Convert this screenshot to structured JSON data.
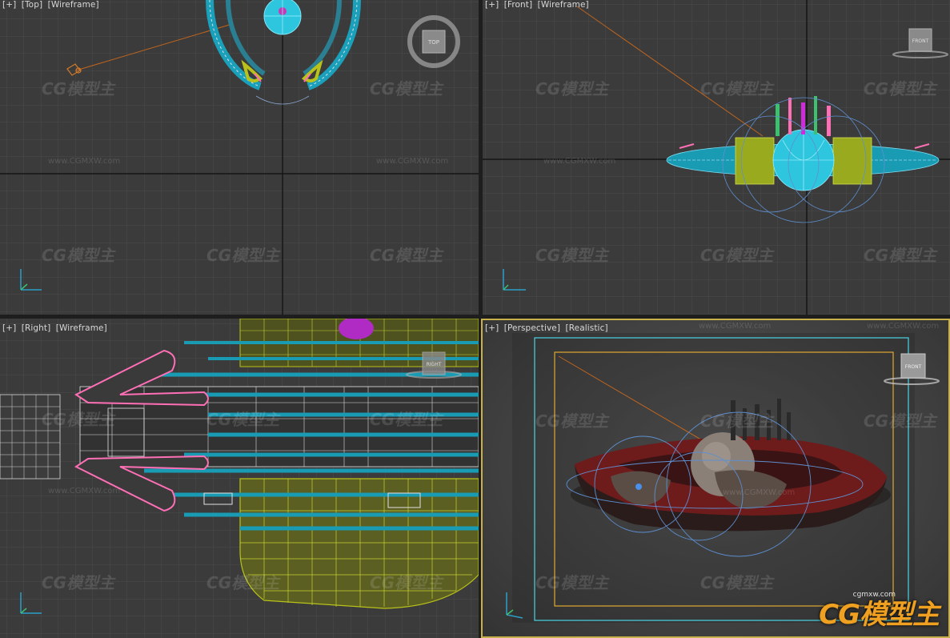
{
  "viewports": {
    "top": {
      "plus": "[+]",
      "view": "[Top]",
      "shading": "[Wireframe]",
      "cube": "TOP"
    },
    "front": {
      "plus": "[+]",
      "view": "[Front]",
      "shading": "[Wireframe]",
      "cube": "FRONT"
    },
    "right": {
      "plus": "[+]",
      "view": "[Right]",
      "shading": "[Wireframe]",
      "cube": "RIGHT"
    },
    "persp": {
      "plus": "[+]",
      "view": "[Perspective]",
      "shading": "[Realistic]",
      "cube": "FRONT"
    }
  },
  "watermark": {
    "brand": "CG模型主",
    "url": "www.CGMXW.com"
  },
  "logo": {
    "text": "CG模型主",
    "url": "cgmxw.com"
  },
  "axis": {
    "x": "x",
    "y": "y",
    "z": "z"
  },
  "colors": {
    "viewport_bg": "#3b3b3b",
    "grid_minor": "#4a4a4a",
    "grid_major": "#262626",
    "active_border": "#c8b04a",
    "cyan": "#18a6c0",
    "yellow_green": "#b9c21a",
    "pink": "#ff6fb5",
    "red_hull": "#7a1e1e"
  }
}
